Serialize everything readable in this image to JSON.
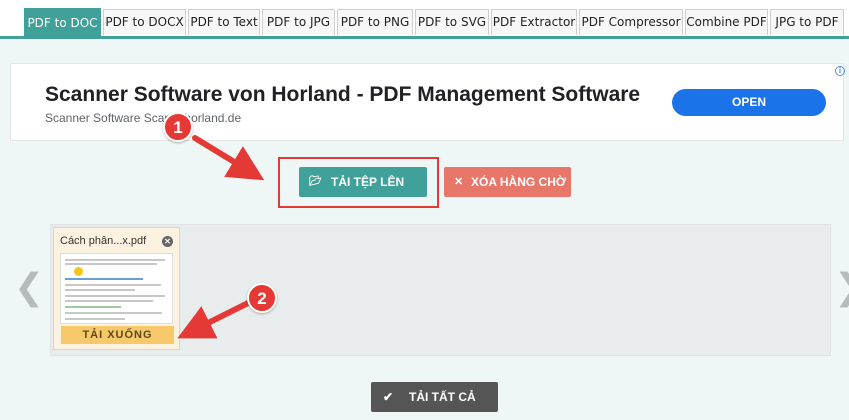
{
  "tabs": [
    {
      "label": "PDF to DOC",
      "active": true
    },
    {
      "label": "PDF to DOCX",
      "active": false
    },
    {
      "label": "PDF to Text",
      "active": false
    },
    {
      "label": "PDF to JPG",
      "active": false
    },
    {
      "label": "PDF to PNG",
      "active": false
    },
    {
      "label": "PDF to SVG",
      "active": false
    },
    {
      "label": "PDF Extractor",
      "active": false
    },
    {
      "label": "PDF Compressor",
      "active": false
    },
    {
      "label": "Combine PDF",
      "active": false
    },
    {
      "label": "JPG to PDF",
      "active": false
    }
  ],
  "ad": {
    "title": "Scanner Software von Horland - PDF Management Software",
    "subtitle": "Scanner Software Scan... horland.de",
    "open_label": "OPEN",
    "info_icon": "info-icon"
  },
  "actions": {
    "upload_label": "TẢI TỆP LÊN",
    "upload_icon": "folder-open-icon",
    "clear_label": "XÓA HÀNG CHỜ",
    "clear_icon": "close-icon",
    "download_all_label": "TẢI TẤT CẢ",
    "download_all_icon": "checkmark-icon"
  },
  "queue": {
    "prev_icon": "chevron-left-icon",
    "next_icon": "chevron-right-icon",
    "files": [
      {
        "name": "Cách phân...x.pdf",
        "download_label": "TẢI XUỐNG"
      }
    ]
  },
  "annotations": {
    "marker1": "1",
    "marker2": "2",
    "color": "#e53935"
  },
  "colors": {
    "accent": "#3fa199",
    "danger": "#e8776a",
    "download": "#f7c96a",
    "ad_button": "#1a73e8"
  }
}
